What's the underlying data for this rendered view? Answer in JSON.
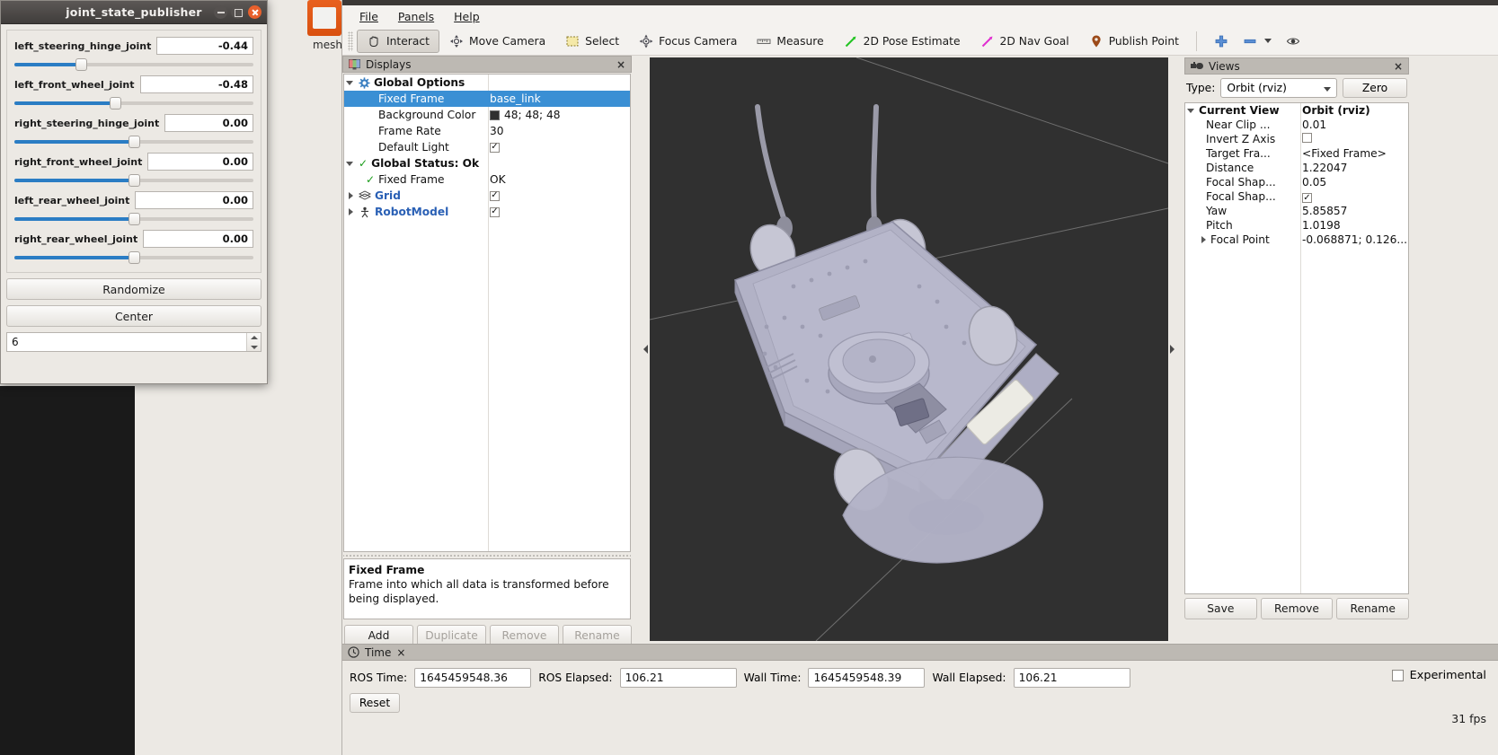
{
  "joint_publisher": {
    "window_title": "joint_state_publisher",
    "window_buttons": {
      "minimize": "minimize-icon",
      "maximize": "maximize-icon",
      "close": "close-icon"
    },
    "joints": [
      {
        "label": "left_steering_hinge_joint",
        "value": "-0.44",
        "slider_pct": 28
      },
      {
        "label": "left_front_wheel_joint",
        "value": "-0.48",
        "slider_pct": 42
      },
      {
        "label": "right_steering_hinge_joint",
        "value": "0.00",
        "slider_pct": 50
      },
      {
        "label": "right_front_wheel_joint",
        "value": "0.00",
        "slider_pct": 50
      },
      {
        "label": "left_rear_wheel_joint",
        "value": "0.00",
        "slider_pct": 50
      },
      {
        "label": "right_rear_wheel_joint",
        "value": "0.00",
        "slider_pct": 50
      }
    ],
    "randomize_label": "Randomize",
    "center_label": "Center",
    "spinbox_value": "6"
  },
  "rviz": {
    "menu": [
      {
        "label": "File"
      },
      {
        "label": "Panels"
      },
      {
        "label": "Help"
      }
    ],
    "toolbar": [
      {
        "label": "Interact",
        "icon": "hand-icon",
        "active": true
      },
      {
        "label": "Move Camera",
        "icon": "move-camera-icon",
        "active": false
      },
      {
        "label": "Select",
        "icon": "select-rect-icon",
        "active": false
      },
      {
        "label": "Focus Camera",
        "icon": "focus-camera-icon",
        "active": false
      },
      {
        "label": "Measure",
        "icon": "ruler-icon",
        "active": false
      },
      {
        "label": "2D Pose Estimate",
        "icon": "green-arrow-icon",
        "active": false
      },
      {
        "label": "2D Nav Goal",
        "icon": "magenta-arrow-icon",
        "active": false
      },
      {
        "label": "Publish Point",
        "icon": "map-pin-icon",
        "active": false
      }
    ],
    "toolbar_right": [
      {
        "icon": "plus-icon"
      },
      {
        "icon": "minus-icon"
      },
      {
        "icon": "eye-icon"
      }
    ],
    "displays": {
      "panel_title": "Displays",
      "panel_icon": "displays-icon",
      "close_icon": "×",
      "rows": [
        {
          "indent": 0,
          "expander": "down",
          "icon": "gear-icon",
          "name": "Global Options",
          "value": "",
          "value_type": "none",
          "selected": false,
          "bold": true,
          "blue": false
        },
        {
          "indent": 1,
          "expander": "none",
          "icon": "none",
          "name": "Fixed Frame",
          "value": "base_link",
          "value_type": "text",
          "selected": true,
          "bold": false,
          "blue": false
        },
        {
          "indent": 1,
          "expander": "none",
          "icon": "none",
          "name": "Background Color",
          "value": "48; 48; 48",
          "value_type": "color",
          "selected": false,
          "bold": false,
          "blue": false
        },
        {
          "indent": 1,
          "expander": "none",
          "icon": "none",
          "name": "Frame Rate",
          "value": "30",
          "value_type": "text",
          "selected": false,
          "bold": false,
          "blue": false
        },
        {
          "indent": 1,
          "expander": "none",
          "icon": "none",
          "name": "Default Light",
          "value": "checked",
          "value_type": "check",
          "selected": false,
          "bold": false,
          "blue": false
        },
        {
          "indent": 0,
          "expander": "down",
          "icon": "check-icon",
          "name": "Global Status: Ok",
          "value": "",
          "value_type": "none",
          "selected": false,
          "bold": true,
          "blue": false
        },
        {
          "indent": 1,
          "expander": "none",
          "icon": "check-icon",
          "name": "Fixed Frame",
          "value": "OK",
          "value_type": "text",
          "selected": false,
          "bold": false,
          "blue": false
        },
        {
          "indent": 0,
          "expander": "right",
          "icon": "grid-icon",
          "name": "Grid",
          "value": "checked",
          "value_type": "check",
          "selected": false,
          "bold": true,
          "blue": true
        },
        {
          "indent": 0,
          "expander": "right",
          "icon": "robot-icon",
          "name": "RobotModel",
          "value": "checked",
          "value_type": "check",
          "selected": false,
          "bold": true,
          "blue": true
        }
      ],
      "help_title": "Fixed Frame",
      "help_text": "Frame into which all data is transformed before being displayed.",
      "buttons": [
        {
          "label": "Add",
          "disabled": false
        },
        {
          "label": "Duplicate",
          "disabled": true
        },
        {
          "label": "Remove",
          "disabled": true
        },
        {
          "label": "Rename",
          "disabled": true
        }
      ]
    },
    "views": {
      "panel_title": "Views",
      "panel_icon": "views-camera-icon",
      "close_icon": "×",
      "type_label": "Type:",
      "type_value": "Orbit (rviz)",
      "zero_label": "Zero",
      "header_name": "Current View",
      "header_value": "Orbit (rviz)",
      "rows": [
        {
          "name": "Near Clip ...",
          "value": "0.01",
          "value_type": "text",
          "expander": "none"
        },
        {
          "name": "Invert Z Axis",
          "value": "unchecked",
          "value_type": "check",
          "expander": "none"
        },
        {
          "name": "Target Fra...",
          "value": "<Fixed Frame>",
          "value_type": "text",
          "expander": "none"
        },
        {
          "name": "Distance",
          "value": "1.22047",
          "value_type": "text",
          "expander": "none"
        },
        {
          "name": "Focal Shap...",
          "value": "0.05",
          "value_type": "text",
          "expander": "none"
        },
        {
          "name": "Focal Shap...",
          "value": "checked",
          "value_type": "check",
          "expander": "none"
        },
        {
          "name": "Yaw",
          "value": "5.85857",
          "value_type": "text",
          "expander": "none"
        },
        {
          "name": "Pitch",
          "value": "1.0198",
          "value_type": "text",
          "expander": "none"
        },
        {
          "name": "Focal Point",
          "value": "-0.068871; 0.126...",
          "value_type": "text",
          "expander": "right"
        }
      ],
      "buttons": [
        {
          "label": "Save",
          "disabled": false
        },
        {
          "label": "Remove",
          "disabled": false
        },
        {
          "label": "Rename",
          "disabled": false
        }
      ]
    },
    "time": {
      "panel_title": "Time",
      "panel_icon": "clock-icon",
      "close_icon": "×",
      "fields": [
        {
          "label": "ROS Time:",
          "value": "1645459548.36"
        },
        {
          "label": "ROS Elapsed:",
          "value": "106.21"
        },
        {
          "label": "Wall Time:",
          "value": "1645459548.39"
        },
        {
          "label": "Wall Elapsed:",
          "value": "106.21"
        }
      ],
      "reset_label": "Reset",
      "experimental_label": "Experimental",
      "experimental_checked": false,
      "fps_label": "31 fps"
    },
    "background_window_text": "mesh"
  },
  "colors": {
    "accent_blue": "#2b7dc4",
    "selection_blue": "#3a8fd4",
    "viewport_bg": "#303030",
    "panel_bg": "#ece9e4",
    "panel_header": "#bdb9b3",
    "robot_body": "#b0b0c8",
    "link_blue": "#2a60b5",
    "status_green": "#1a9c1a",
    "pose_green": "#22c422",
    "nav_magenta": "#e030d0",
    "pin_brown": "#9c4a18"
  }
}
